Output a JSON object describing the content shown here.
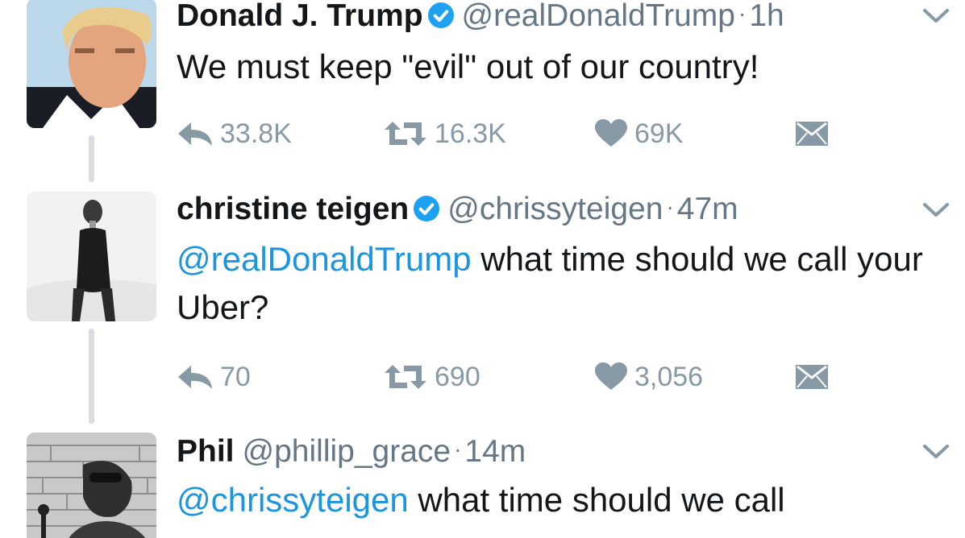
{
  "tweets": [
    {
      "name": "Donald J. Trump",
      "verified": true,
      "handle": "@realDonaldTrump",
      "time": "1h",
      "mention": "",
      "text": "We must keep \"evil\" out of our country!",
      "reply_count": "33.8K",
      "retweet_count": "16.3K",
      "like_count": "69K"
    },
    {
      "name": "christine teigen",
      "verified": true,
      "handle": "@chrissyteigen",
      "time": "47m",
      "mention": "@realDonaldTrump",
      "text": " what time should we call your Uber?",
      "reply_count": "70",
      "retweet_count": "690",
      "like_count": "3,056"
    },
    {
      "name": "Phil",
      "verified": false,
      "handle": "@phillip_grace",
      "time": "14m",
      "mention": "@chrissyteigen",
      "text": " what time should we call",
      "reply_count": "",
      "retweet_count": "",
      "like_count": ""
    }
  ],
  "separator": "·",
  "colors": {
    "name": "#14171a",
    "meta": "#657786",
    "action": "#8899a6",
    "mention": "#1b95e0",
    "verified": "#1da1f2",
    "connector": "#d9dde1"
  },
  "icons": [
    "reply-icon",
    "retweet-icon",
    "like-icon",
    "direct-message-icon",
    "chevron-down-icon",
    "verified-badge-icon"
  ]
}
